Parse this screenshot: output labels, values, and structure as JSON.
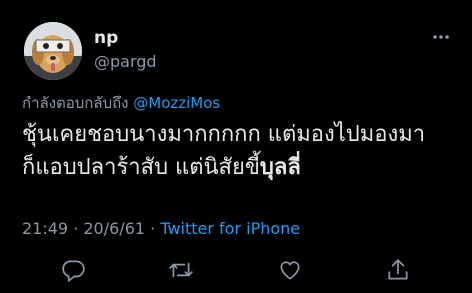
{
  "user": {
    "display_name": "np",
    "handle": "@pargd"
  },
  "reply_context": {
    "prefix": "กำลังตอบกลับถึง ",
    "mention": "@MozziMos"
  },
  "tweet": {
    "line1": "ชุ้นเคยชอบนางมากกกกก แต่มองไปมองมา",
    "line2_regular": "ก็แอบปลาร้าสับ แต่นิสัยขี้",
    "line2_bold": "บุลลี่"
  },
  "meta": {
    "time": "21:49",
    "sep1": " · ",
    "date": "20/6/61",
    "sep2": " · ",
    "source": "Twitter for iPhone"
  },
  "icons": {
    "more": "more-icon",
    "reply": "reply-icon",
    "retweet": "retweet-icon",
    "like": "like-icon",
    "share": "share-icon"
  },
  "colors": {
    "background": "#000000",
    "text": "#e7e9ea",
    "secondary": "#8b98a5",
    "accent": "#1d9bf0"
  }
}
